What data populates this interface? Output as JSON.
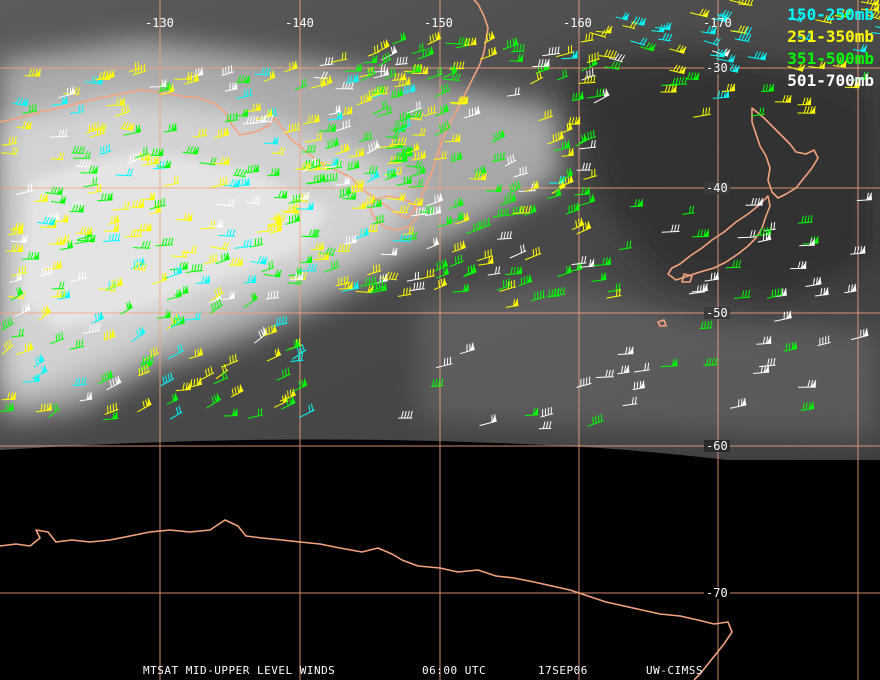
{
  "image": {
    "title": "MTSAT MID-UPPER LEVEL WINDS",
    "time": "06:00 UTC",
    "date": "17SEP06",
    "credit": "UW-CIMSS"
  },
  "grid": {
    "longitude_labels": [
      "-130",
      "-140",
      "-150",
      "-160",
      "-170"
    ],
    "latitude_labels": [
      "-30",
      "-40",
      "-50",
      "-60",
      "-70"
    ]
  },
  "legend": [
    {
      "label": "150-250mb",
      "color": "#00ffff"
    },
    {
      "label": "251-350mb",
      "color": "#ffff00"
    },
    {
      "label": "351-500mb",
      "color": "#00ff00"
    },
    {
      "label": "501-700mb",
      "color": "#ffffff"
    }
  ],
  "colors": {
    "coastline": "#f4a37e",
    "gridline": "#f4a37e",
    "space": "#000000",
    "cloud_bright": "#e8e8e8",
    "sky_dark": "#505050"
  }
}
